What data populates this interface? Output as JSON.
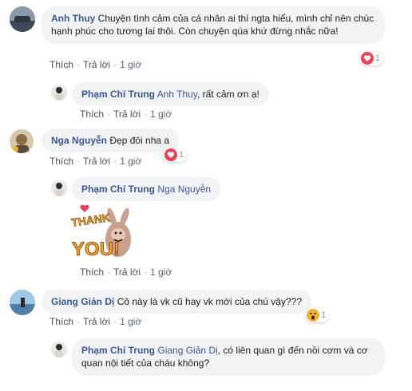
{
  "actions": {
    "like": "Thích",
    "reply": "Trả lời",
    "sep": "·"
  },
  "comments": [
    {
      "author": "Anh Thuy",
      "text": "Chuyện tình cảm của cá nhân ai thì ngta hiểu, mình chỉ nên chúc hạnh phúc cho tương lai thôi. Còn chuyện qúa khứ đừng nhắc nữa!",
      "time": "1 giờ",
      "reaction": {
        "type": "love",
        "count": "1"
      }
    },
    {
      "author": "Phạm Chí Trung",
      "mention": "Anh Thuy",
      "text": ", rất cảm ơn ạ!",
      "time": "1 giờ"
    },
    {
      "author": "Nga Nguyễn",
      "text": "Đẹp đôi nha a",
      "time": "1 giờ",
      "reaction": {
        "type": "love",
        "count": "1"
      }
    },
    {
      "author": "Phạm Chí Trung",
      "mention": "Nga Nguyễn",
      "time": "1 giờ",
      "sticker": {
        "line1": "THANK",
        "line2": "YOU!"
      }
    },
    {
      "author": "Giang Giản Dị",
      "text": "Cô này là vk cũ hay vk mới của chú vậy???",
      "time": "1 giờ",
      "reaction": {
        "type": "wow",
        "count": "1"
      }
    },
    {
      "author": "Phạm Chí Trung",
      "mention": "Giang Giản Dị",
      "text": ", có liên quan gì đến nồi cơm và cơ quan nội tiết của cháu không?"
    }
  ],
  "colors": {
    "name": "#385898",
    "bubble": "#f2f3f5",
    "love": "#f33e58",
    "wow": "#f7b125"
  }
}
